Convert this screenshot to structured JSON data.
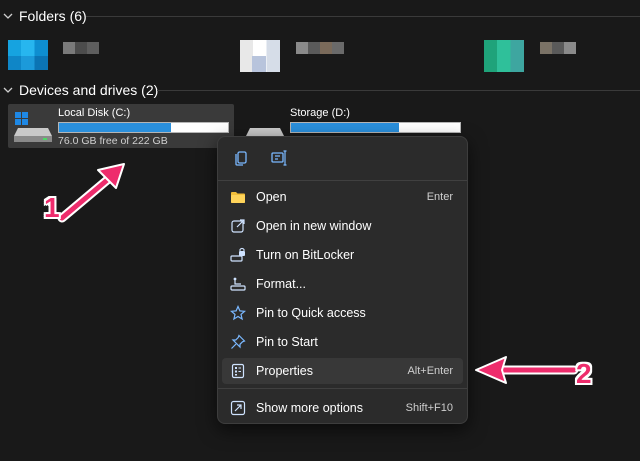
{
  "folders_section": {
    "label": "Folders (6)"
  },
  "devices_section": {
    "label": "Devices and drives (2)"
  },
  "drives": [
    {
      "name": "Local Disk (C:)",
      "free_text": "76.0 GB free of 222 GB",
      "used_fraction": 0.66
    },
    {
      "name": "Storage (D:)",
      "used_fraction": 0.64
    }
  ],
  "context_menu": {
    "items": [
      {
        "label": "Open",
        "shortcut": "Enter",
        "icon": "folder-icon"
      },
      {
        "label": "Open in new window",
        "shortcut": "",
        "icon": "open-new-window-icon"
      },
      {
        "label": "Turn on BitLocker",
        "shortcut": "",
        "icon": "bitlocker-icon"
      },
      {
        "label": "Format...",
        "shortcut": "",
        "icon": "format-icon"
      },
      {
        "label": "Pin to Quick access",
        "shortcut": "",
        "icon": "star-icon"
      },
      {
        "label": "Pin to Start",
        "shortcut": "",
        "icon": "pin-icon"
      },
      {
        "label": "Properties",
        "shortcut": "Alt+Enter",
        "icon": "properties-icon"
      },
      {
        "label": "Show more options",
        "shortcut": "Shift+F10",
        "icon": "more-options-icon"
      }
    ]
  },
  "annotations": {
    "callout_1": "1",
    "callout_2": "2",
    "color": "#ee2c6c"
  },
  "colors": {
    "accent": "#2a8fdc",
    "background": "#191919",
    "menu_bg": "#2b2b2b"
  }
}
